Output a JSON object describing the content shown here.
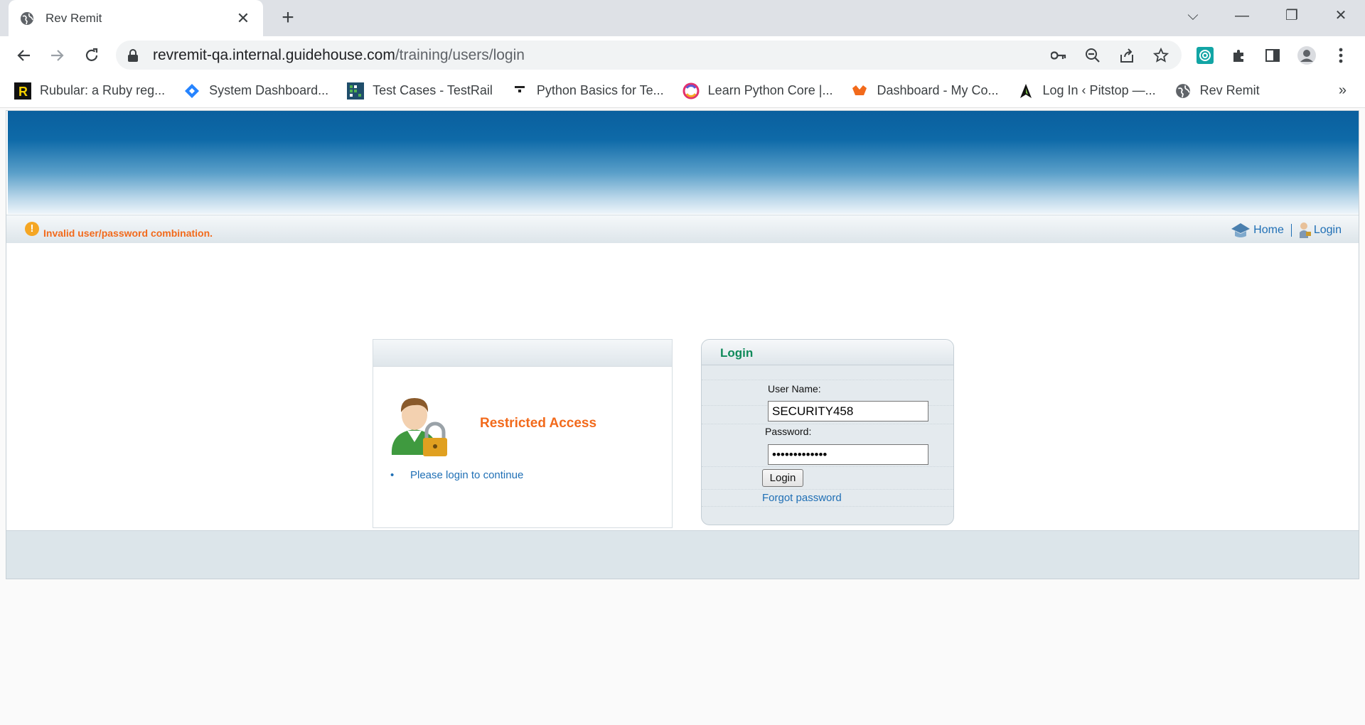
{
  "browser": {
    "tab_title": "Rev Remit",
    "url_host": "revremit-qa.internal.guidehouse.com",
    "url_path": "/training/users/login",
    "bookmarks": [
      {
        "label": "Rubular: a Ruby reg...",
        "icon": "rubular-icon"
      },
      {
        "label": "System Dashboard...",
        "icon": "jira-icon"
      },
      {
        "label": "Test Cases - TestRail",
        "icon": "testrail-icon"
      },
      {
        "label": "Python Basics for Te...",
        "icon": "python-basics-icon"
      },
      {
        "label": "Learn Python Core |...",
        "icon": "learn-python-icon"
      },
      {
        "label": "Dashboard - My Co...",
        "icon": "dashboard-icon"
      },
      {
        "label": "Log In ‹ Pitstop —...",
        "icon": "pitstop-icon"
      },
      {
        "label": "Rev Remit",
        "icon": "globe-icon"
      }
    ],
    "more_bookmarks": "»"
  },
  "app": {
    "message": "Invalid user/password combination.",
    "nav": {
      "home": "Home",
      "login": "Login"
    },
    "restricted": {
      "title": "Restricted Access",
      "bullet": "Please login to continue"
    },
    "login_form": {
      "title": "Login",
      "username_label": "User Name:",
      "username_value": "SECURITY458",
      "password_label": "Password:",
      "password_value": "•••••••••••••",
      "submit_label": "Login",
      "forgot_label": "Forgot password"
    }
  }
}
